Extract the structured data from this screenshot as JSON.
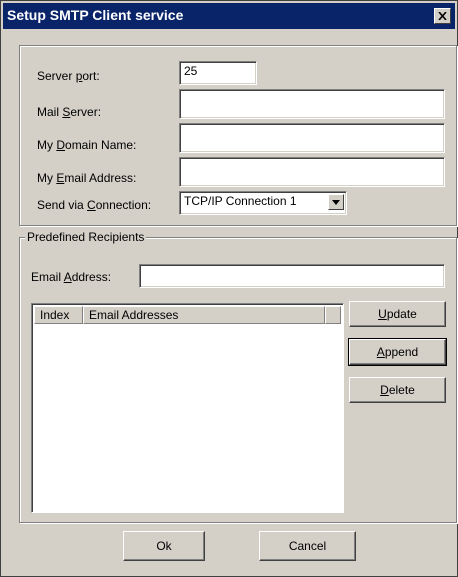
{
  "window": {
    "title": "Setup SMTP Client service",
    "close_glyph": "✕"
  },
  "fields": {
    "server_port": {
      "label_pre": "Server ",
      "label_key": "p",
      "label_post": "ort:",
      "value": "25"
    },
    "mail_server": {
      "label_pre": "Mail ",
      "label_key": "S",
      "label_post": "erver:",
      "value": ""
    },
    "domain_name": {
      "label_pre": "My ",
      "label_key": "D",
      "label_post": "omain Name:",
      "value": ""
    },
    "email_address": {
      "label_pre": "My ",
      "label_key": "E",
      "label_post": "mail Address:",
      "value": ""
    },
    "send_via": {
      "label_pre": "Send via ",
      "label_key": "C",
      "label_post": "onnection:",
      "value": "TCP/IP Connection 1"
    }
  },
  "recipients": {
    "group_title": "Predefined Recipients",
    "email_label_pre": "Email ",
    "email_label_key": "A",
    "email_label_post": "ddress:",
    "email_value": "",
    "columns": [
      "Index",
      "Email Addresses"
    ],
    "rows": []
  },
  "buttons": {
    "update": {
      "key": "U",
      "rest": "pdate"
    },
    "append": {
      "key": "A",
      "rest": "ppend"
    },
    "delete": {
      "key": "D",
      "rest": "elete"
    },
    "ok": "Ok",
    "cancel": "Cancel"
  },
  "icons": {
    "dropdown": "combo-dropdown-arrow-icon",
    "close": "close-icon"
  }
}
